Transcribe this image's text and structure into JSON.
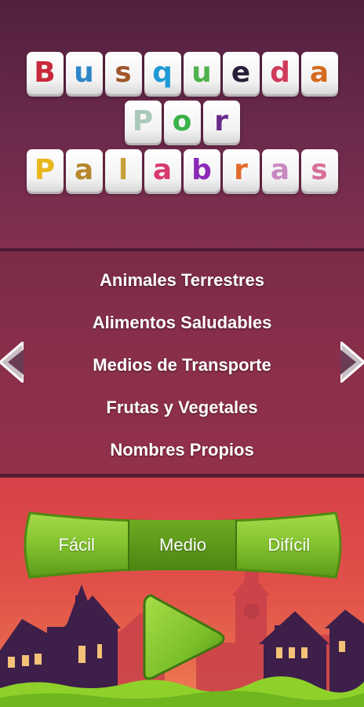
{
  "title": {
    "rows": [
      [
        {
          "ch": "B",
          "color": "#c8283a"
        },
        {
          "ch": "u",
          "color": "#2e86c8"
        },
        {
          "ch": "s",
          "color": "#a0562a"
        },
        {
          "ch": "q",
          "color": "#1f9ad6"
        },
        {
          "ch": "u",
          "color": "#4fb24c"
        },
        {
          "ch": "e",
          "color": "#2a1f3a"
        },
        {
          "ch": "d",
          "color": "#d03a5a"
        },
        {
          "ch": "a",
          "color": "#d46a1e"
        }
      ],
      [
        {
          "ch": "P",
          "color": "#aac9b9"
        },
        {
          "ch": "o",
          "color": "#39b24a"
        },
        {
          "ch": "r",
          "color": "#6a2a8c"
        }
      ],
      [
        {
          "ch": "P",
          "color": "#e8b81e"
        },
        {
          "ch": "a",
          "color": "#b6872e"
        },
        {
          "ch": "l",
          "color": "#c8a03a"
        },
        {
          "ch": "a",
          "color": "#d83a6e"
        },
        {
          "ch": "b",
          "color": "#8a2ab6"
        },
        {
          "ch": "r",
          "color": "#e26a2a"
        },
        {
          "ch": "a",
          "color": "#c889c0"
        },
        {
          "ch": "s",
          "color": "#d8709a"
        }
      ]
    ]
  },
  "categories": [
    "Animales Terrestres",
    "Alimentos Saludables",
    "Medios de Transporte",
    "Frutas y Vegetales",
    "Nombres Propios"
  ],
  "difficulty": {
    "easy": "Fácil",
    "medium": "Medio",
    "hard": "Difícil",
    "selected": "medium"
  },
  "icons": {
    "left_arrow": "chevron-left-icon",
    "right_arrow": "chevron-right-icon",
    "play": "play-icon"
  },
  "colors": {
    "button_green": "#7cc02a",
    "button_green_dark": "#5a9a17",
    "house_purple": "#3d1f4a"
  }
}
